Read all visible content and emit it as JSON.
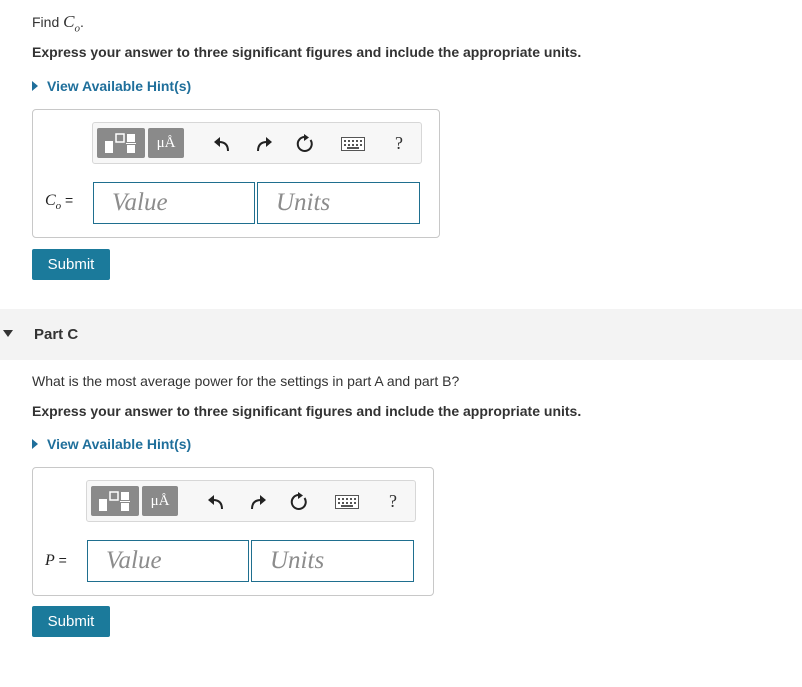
{
  "partB": {
    "prompt_prefix": "Find ",
    "prompt_var": "C",
    "prompt_sub": "o",
    "prompt_suffix": ".",
    "instruction": "Express your answer to three significant figures and include the appropriate units.",
    "hint_label": "View Available Hint(s)",
    "var_name": "C",
    "var_sub": "o",
    "equals": " =",
    "value_placeholder": "Value",
    "units_placeholder": "Units",
    "submit_label": "Submit"
  },
  "partC": {
    "title": "Part C",
    "prompt": "What is the most average power for the settings in part A and part B?",
    "instruction": "Express your answer to three significant figures and include the appropriate units.",
    "hint_label": "View Available Hint(s)",
    "var_name": "P",
    "equals": " =",
    "value_placeholder": "Value",
    "units_placeholder": "Units",
    "submit_label": "Submit"
  },
  "toolbar": {
    "units_symbol": "μÅ",
    "help_label": "?"
  },
  "colors": {
    "accent": "#1b7a9b",
    "link": "#1f6f9b",
    "field_border": "#1f6f8f"
  },
  "icons": [
    "templates-icon",
    "units-icon",
    "undo-icon",
    "redo-icon",
    "reset-icon",
    "keyboard-icon",
    "help-icon",
    "caret-down-icon"
  ]
}
